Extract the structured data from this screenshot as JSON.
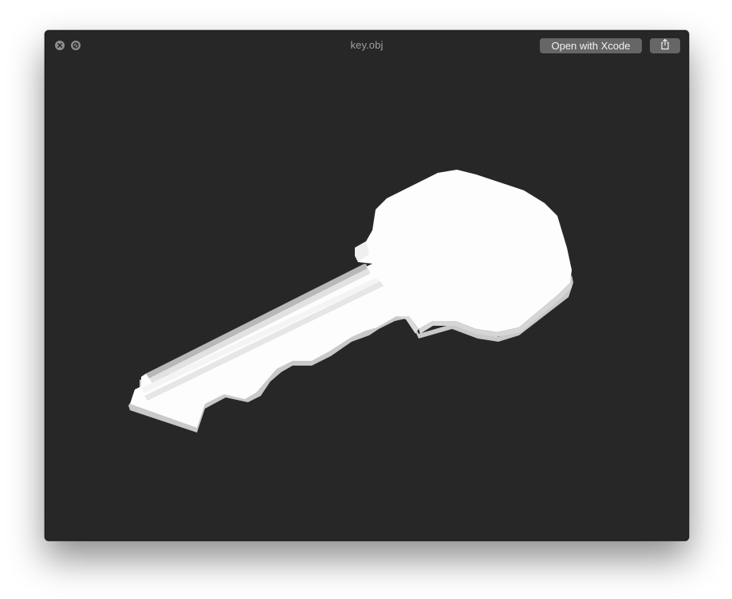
{
  "window": {
    "title": "key.obj",
    "close_icon": "close-icon",
    "minimize_icon": "minimize-icon"
  },
  "toolbar": {
    "open_with_label": "Open with Xcode",
    "share_icon": "share-icon"
  },
  "viewport": {
    "model": "3d-key-model",
    "background_color": "#272727",
    "model_color": "#fdfdfd"
  }
}
